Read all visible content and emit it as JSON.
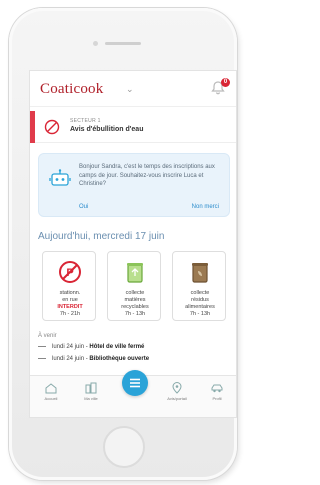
{
  "header": {
    "logo_text": "Coaticook",
    "chevron": "⌄",
    "notification_count": "0"
  },
  "alert": {
    "sector": "Secteur 1",
    "text": "Avis d'ébullition d'eau",
    "accent": "#e03b4a"
  },
  "assistant": {
    "message": "Bonjour Sandra, c'est le temps des inscriptions aux camps de jour. Souhaitez-vous inscrire Luca et Christine?",
    "yes_label": "Oui",
    "no_label": "Non merci"
  },
  "today": {
    "title": "Aujourd'hui, mercredi 17 juin",
    "tiles": [
      {
        "line1": "stationn.",
        "line2": "en rue",
        "line3": "INTERDIT",
        "line4": "7h - 21h",
        "icon": "no-parking-icon"
      },
      {
        "line1": "collecte",
        "line2": "matières",
        "line3": "recyclables",
        "line4": "7h - 13h",
        "icon": "recycling-bin-icon"
      },
      {
        "line1": "collecte",
        "line2": "résidus",
        "line3": "alimentaires",
        "line4": "7h - 13h",
        "icon": "compost-bin-icon"
      }
    ]
  },
  "upcoming": {
    "title": "À venir",
    "events": [
      {
        "date": "lundi 24 juin -",
        "label": "Hôtel de ville fermé"
      },
      {
        "date": "lundi 24 juin -",
        "label": "Bibliothèque ouverte"
      }
    ]
  },
  "tabbar": {
    "items": [
      {
        "label": "Accueil",
        "icon": "home-icon"
      },
      {
        "label": "Ma ville",
        "icon": "city-icon"
      },
      {
        "label": "",
        "icon": "menu-icon"
      },
      {
        "label": "Avis/portail",
        "icon": "location-icon"
      },
      {
        "label": "Profil",
        "icon": "car-icon"
      }
    ]
  },
  "colors": {
    "brand": "#b0202a",
    "accent": "#2aa3d8",
    "alert": "#d92535",
    "title": "#6b8fb0"
  }
}
